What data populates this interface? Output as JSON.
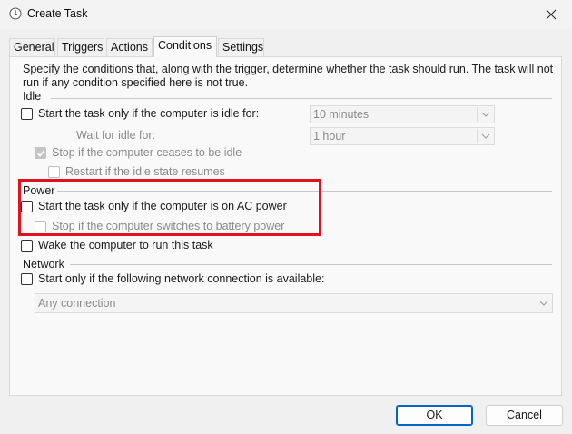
{
  "window": {
    "title": "Create Task",
    "app_icon": "clock-icon",
    "close_icon": "close-icon"
  },
  "tabs": [
    {
      "label": "General"
    },
    {
      "label": "Triggers"
    },
    {
      "label": "Actions"
    },
    {
      "label": "Conditions",
      "active": true
    },
    {
      "label": "Settings"
    }
  ],
  "conditions": {
    "description": "Specify the conditions that, along with the trigger, determine whether the task should run.  The task will not run  if any condition specified here is not true.",
    "idle": {
      "heading": "Idle",
      "start_if_idle_label": "Start the task only if the computer is idle for:",
      "start_if_idle_checked": false,
      "idle_duration_value": "10 minutes",
      "wait_for_idle_label": "Wait for idle for:",
      "wait_for_idle_value": "1 hour",
      "stop_if_ceases_label": "Stop if the computer ceases to be idle",
      "stop_if_ceases_checked": true,
      "restart_if_resumes_label": "Restart if the idle state resumes",
      "restart_if_resumes_checked": false
    },
    "power": {
      "heading": "Power",
      "start_on_ac_label": "Start the task only if the computer is on AC power",
      "start_on_ac_checked": false,
      "stop_on_battery_label": "Stop if the computer switches to battery power",
      "stop_on_battery_checked": false,
      "wake_label": "Wake the computer to run this task",
      "wake_checked": false
    },
    "network": {
      "heading": "Network",
      "start_if_network_label": "Start only if the following network connection is available:",
      "start_if_network_checked": false,
      "connection_value": "Any connection"
    }
  },
  "buttons": {
    "ok": "OK",
    "cancel": "Cancel"
  },
  "colors": {
    "highlight": "#e0121c",
    "primary_button_border": "#0067c0"
  }
}
